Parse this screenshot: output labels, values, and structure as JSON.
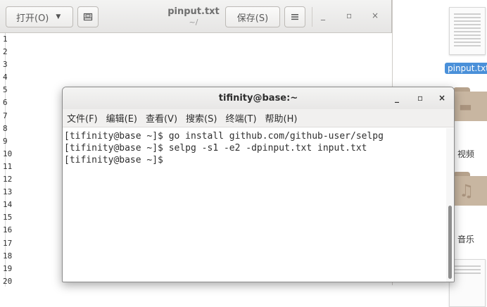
{
  "gedit": {
    "open_label": "打开(O)",
    "pin_icon": "document-open-recent-icon",
    "title": "pinput.txt",
    "path": "~/",
    "save_label": "保存(S)",
    "menu_icon": "hamburger-icon",
    "min": "_",
    "max": "▫",
    "close": "×",
    "line_numbers": [
      "1",
      "2",
      "3",
      "4",
      "5",
      "6",
      "7",
      "8",
      "9",
      "10",
      "11",
      "12",
      "13",
      "14",
      "15",
      "16",
      "17",
      "18",
      "19",
      "20"
    ]
  },
  "desktop": {
    "file_label": "pinput.txt",
    "video_label": "视频",
    "music_label": "音乐"
  },
  "terminal": {
    "title": "tifinity@base:~",
    "min": "_",
    "max": "▫",
    "close": "×",
    "menus": [
      "文件(F)",
      "编辑(E)",
      "查看(V)",
      "搜索(S)",
      "终端(T)",
      "帮助(H)"
    ],
    "lines": [
      "[tifinity@base ~]$ go install github.com/github-user/selpg",
      "[tifinity@base ~]$ selpg -s1 -e2 -dpinput.txt input.txt",
      "[tifinity@base ~]$ "
    ]
  }
}
